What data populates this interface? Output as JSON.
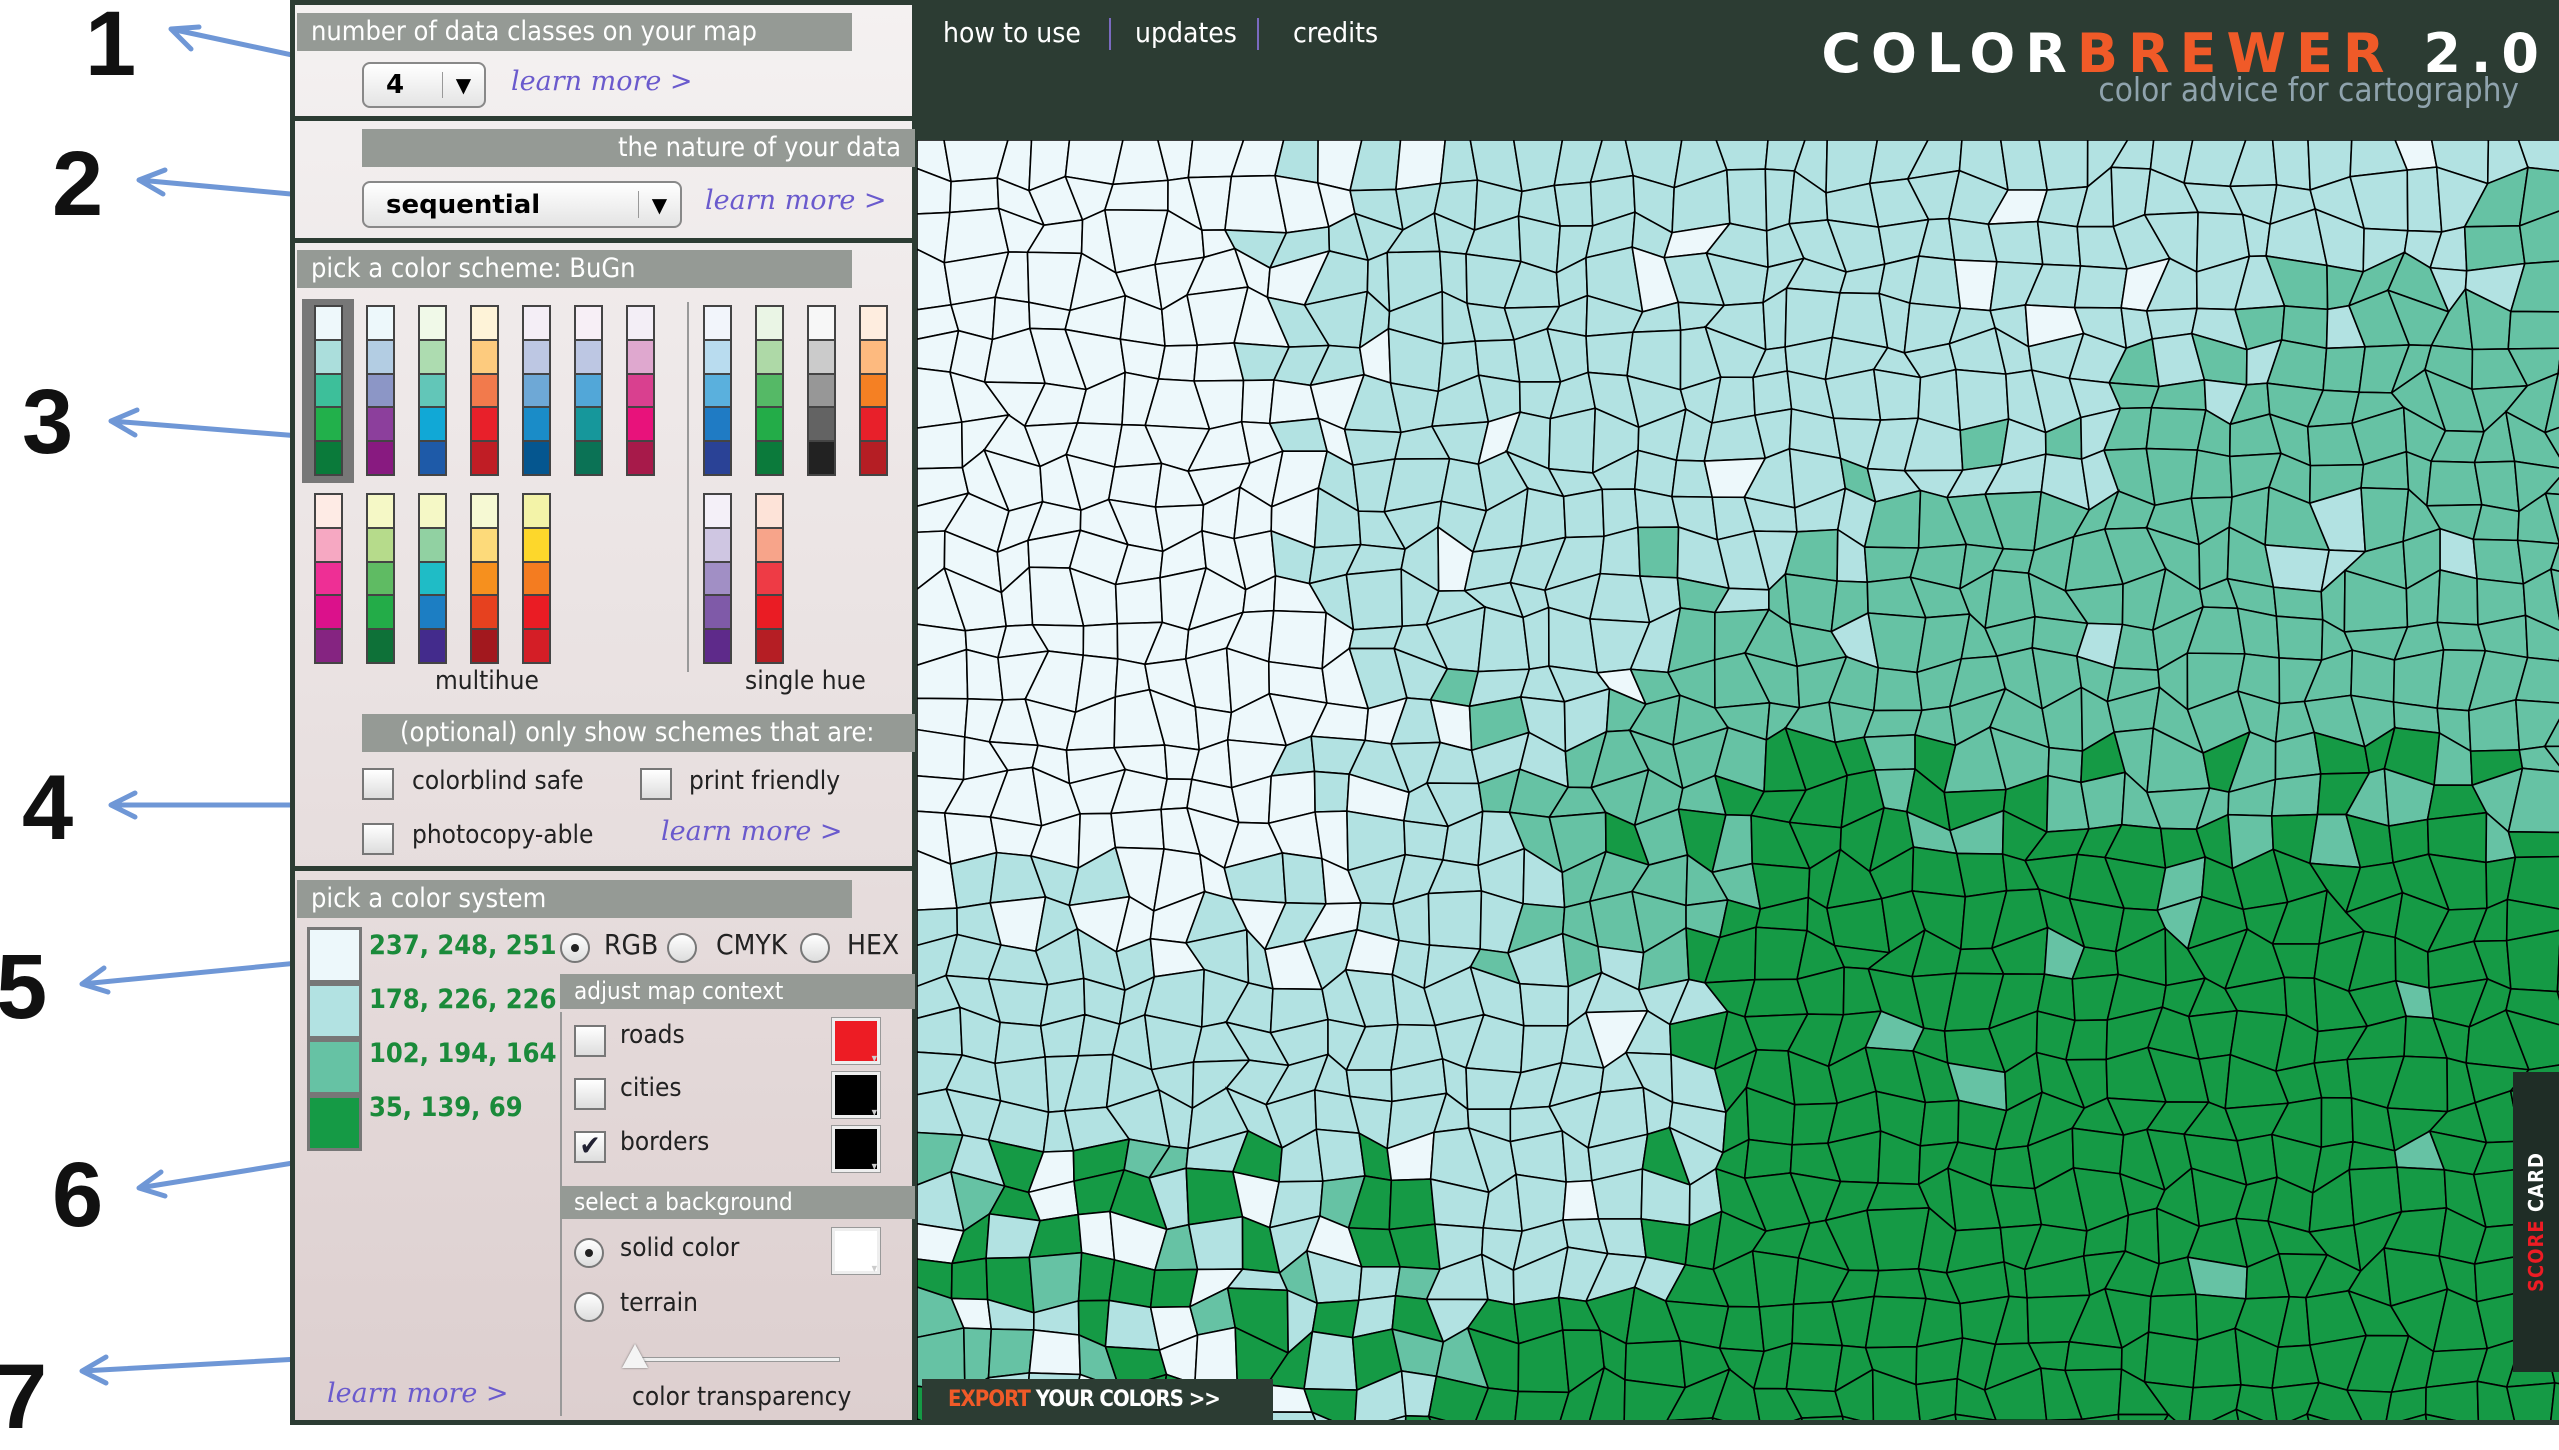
{
  "annotations": [
    "1",
    "2",
    "3",
    "4",
    "5",
    "6",
    "7"
  ],
  "classes": {
    "title": "number of data classes on your map",
    "value": "4",
    "learn_more": "learn more >"
  },
  "nature": {
    "title": "the nature of your data",
    "value": "sequential",
    "learn_more": "learn more >"
  },
  "scheme": {
    "title": "pick a color scheme: BuGn",
    "selected": "BuGn",
    "multihue_label": "multihue",
    "single_hue_label": "single hue",
    "multihue_row1": [
      [
        "#eef8fb",
        "#abdedc",
        "#3dbf9a",
        "#22b04b",
        "#0a7a3a"
      ],
      [
        "#edf8fb",
        "#b3cde3",
        "#8c96c6",
        "#8c3f9c",
        "#881a80"
      ],
      [
        "#f0f9e8",
        "#addcb0",
        "#62c6b8",
        "#11a8d6",
        "#1e5aa8"
      ],
      [
        "#fef3d8",
        "#fdcb7e",
        "#f27a4c",
        "#e8202a",
        "#c01d25"
      ],
      [
        "#f4eef6",
        "#bdc7e3",
        "#6ea8d6",
        "#1a8cc8",
        "#05568f"
      ],
      [
        "#f7eff6",
        "#bdc7e3",
        "#52a7d8",
        "#16979b",
        "#0b7255"
      ],
      [
        "#f3eef6",
        "#dfa8cf",
        "#d9408f",
        "#e8127b",
        "#a71a4a"
      ]
    ],
    "single_row1": [
      [
        "#f2f5fb",
        "#b9dcef",
        "#5ab0dd",
        "#1f7bc4",
        "#2a4296"
      ],
      [
        "#eaf5e5",
        "#aed9a7",
        "#55b966",
        "#23ac48",
        "#0b7a3b"
      ],
      [
        "#f7f7f7",
        "#cbcbcb",
        "#979797",
        "#636363",
        "#222222"
      ],
      [
        "#feeddf",
        "#fdba7f",
        "#f58023",
        "#e8202a",
        "#b51e24"
      ]
    ],
    "multihue_row2": [
      [
        "#feebe5",
        "#f6a8c2",
        "#ee2f95",
        "#db118b",
        "#852481"
      ],
      [
        "#f5f8c6",
        "#b6db8b",
        "#5fbb63",
        "#23ac48",
        "#0e7138"
      ],
      [
        "#f5f8c6",
        "#91d1a2",
        "#1fbcc6",
        "#1c7ec3",
        "#432b8c"
      ],
      [
        "#f6f9d3",
        "#fdda7a",
        "#f6901e",
        "#e6411f",
        "#a2181e"
      ],
      [
        "#f3f3a8",
        "#fdd72b",
        "#f47c20",
        "#ea1c24",
        "#d41e26"
      ]
    ],
    "single_row2": [
      [
        "#f4f0f8",
        "#cfc6e2",
        "#a18fc5",
        "#7f5aa8",
        "#5e2a8a"
      ],
      [
        "#fde3d8",
        "#f7a48a",
        "#ee3b45",
        "#ea1c24",
        "#b51e24"
      ]
    ]
  },
  "filters": {
    "title": "(optional) only show schemes that are:",
    "colorblind": "colorblind safe",
    "print": "print friendly",
    "photocopy": "photocopy-able",
    "learn_more": "learn more >"
  },
  "color_system": {
    "title": "pick a color system",
    "swatches": [
      "#edf8fb",
      "#b2e2e2",
      "#66c2a4",
      "#159a45"
    ],
    "values": [
      "237, 248, 251",
      "178, 226, 226",
      "102, 194, 164",
      "35, 139, 69"
    ],
    "options": [
      "RGB",
      "CMYK",
      "HEX"
    ],
    "selected": "RGB",
    "learn_more": "learn more >"
  },
  "context": {
    "title": "adjust map context",
    "roads": {
      "label": "roads",
      "checked": false,
      "color": "#ed1c24"
    },
    "cities": {
      "label": "cities",
      "checked": false,
      "color": "#000000"
    },
    "borders": {
      "label": "borders",
      "checked": true,
      "color": "#000000"
    }
  },
  "background": {
    "title": "select a background",
    "solid": "solid color",
    "terrain": "terrain",
    "selected": "solid color",
    "solid_color": "#ffffff",
    "transparency_label": "color transparency",
    "transparency": 0
  },
  "header": {
    "nav": [
      "how to use",
      "updates",
      "credits"
    ],
    "logo_color": "COLOR",
    "logo_brewer": "BREWER",
    "logo_version": "2.0",
    "tagline": "color advice for cartography"
  },
  "export": {
    "prefix": "EXPORT",
    "rest": "YOUR COLORS >>"
  },
  "scorecard": {
    "prefix": "SCORE",
    "rest": "CARD"
  },
  "map": {
    "class_colors": [
      "#edf8fb",
      "#b2e2e2",
      "#66c2a4",
      "#159a45"
    ]
  }
}
